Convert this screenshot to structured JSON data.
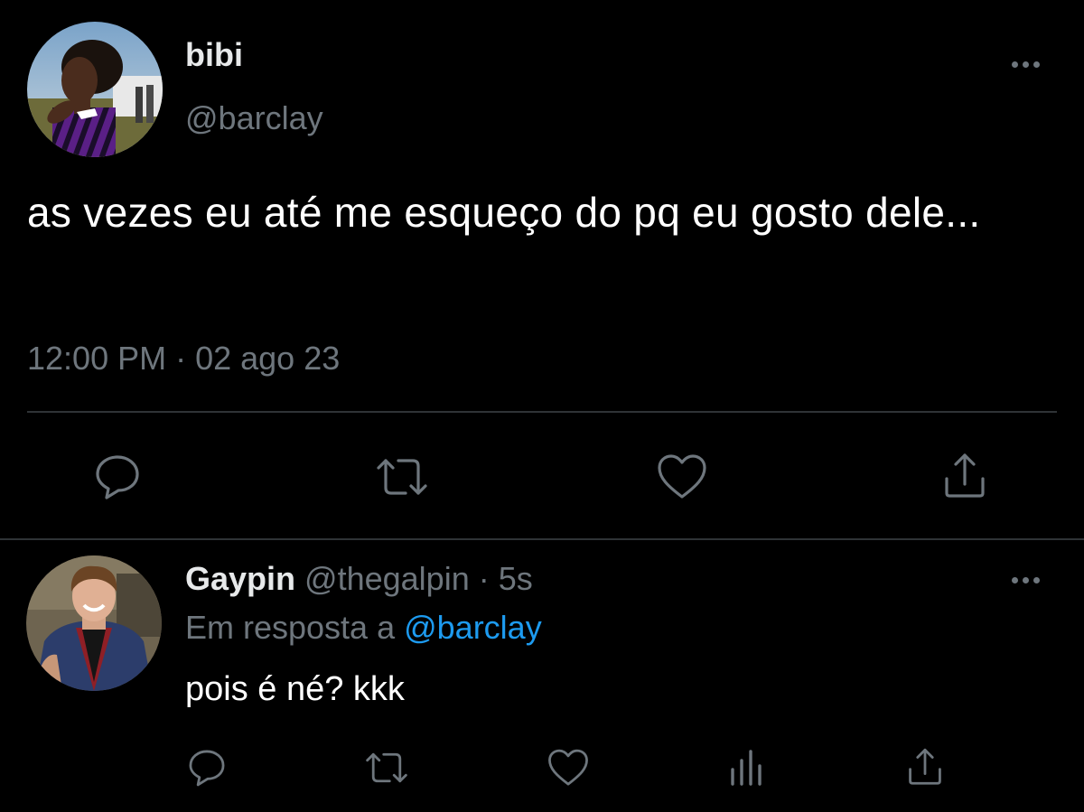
{
  "main_tweet": {
    "display_name": "bibi",
    "handle": "@barclay",
    "text": "as vezes eu até me esqueço do pq eu gosto dele...",
    "timestamp": "12:00 PM · 02 ago 23",
    "actions": [
      "reply-icon",
      "retweet-icon",
      "like-icon",
      "share-icon"
    ]
  },
  "reply_tweet": {
    "display_name": "Gaypin",
    "handle": "@thegalpin",
    "separator": " · ",
    "time_ago": "5s",
    "reply_prefix": "Em resposta a ",
    "reply_to": "@barclay",
    "text": "pois é né? kkk",
    "actions": [
      "reply-icon",
      "retweet-icon",
      "like-icon",
      "analytics-icon",
      "share-icon"
    ]
  },
  "colors": {
    "background": "#000000",
    "primary_text": "#e7e9ea",
    "secondary_text": "#6e767d",
    "accent": "#1d9bf0",
    "divider": "#2f3336"
  }
}
